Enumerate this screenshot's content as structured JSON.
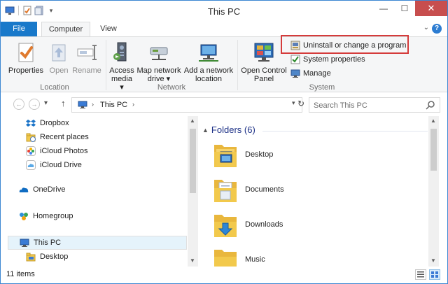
{
  "window": {
    "title": "This PC"
  },
  "window_controls": {
    "minimize": "—",
    "maximize": "☐",
    "close": "✕"
  },
  "ribbon_tabs": {
    "file": "File",
    "computer": "Computer",
    "view": "View",
    "minimize_ribbon": "⌄",
    "help": "?"
  },
  "ribbon": {
    "location": {
      "label": "Location",
      "properties": "Properties",
      "open": "Open",
      "rename": "Rename"
    },
    "network": {
      "label": "Network",
      "access_media_line1": "Access",
      "access_media_line2": "media ▾",
      "map_drive_line1": "Map network",
      "map_drive_line2": "drive ▾",
      "add_location_line1": "Add a network",
      "add_location_line2": "location"
    },
    "system": {
      "label": "System",
      "open_cp_line1": "Open Control",
      "open_cp_line2": "Panel",
      "uninstall": "Uninstall or change a program",
      "system_properties": "System properties",
      "manage": "Manage"
    }
  },
  "address_bar": {
    "back": "←",
    "forward": "→",
    "recent": "▾",
    "up": "↑",
    "crumb": "This PC",
    "chevron": "›",
    "dropdown": "▾",
    "refresh": "↻"
  },
  "search": {
    "placeholder": "Search This PC"
  },
  "nav_pane": {
    "items": [
      {
        "label": "Dropbox"
      },
      {
        "label": "Recent places"
      },
      {
        "label": "iCloud Photos"
      },
      {
        "label": "iCloud Drive"
      },
      {
        "label": "OneDrive"
      },
      {
        "label": "Homegroup"
      },
      {
        "label": "This PC"
      },
      {
        "label": "Desktop"
      }
    ]
  },
  "content": {
    "group_header": "Folders (6)",
    "folders": [
      {
        "label": "Desktop"
      },
      {
        "label": "Documents"
      },
      {
        "label": "Downloads"
      },
      {
        "label": "Music"
      }
    ]
  },
  "status_bar": {
    "item_count": "11 items"
  },
  "colors": {
    "file_tab": "#1979ca",
    "highlight_border": "#d53b3b",
    "close_button": "#c74e4e",
    "folder_yellow": "#f2c94c"
  }
}
